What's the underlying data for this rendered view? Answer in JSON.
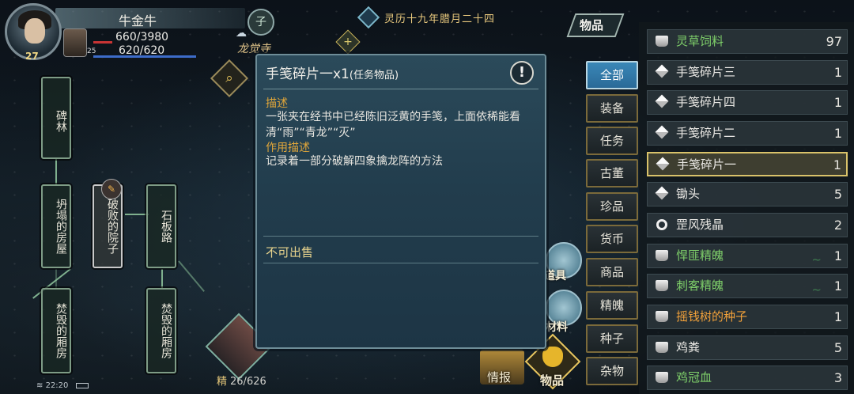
{
  "player": {
    "name": "牛金牛",
    "level": "27",
    "hp": "660/3980",
    "mp": "620/620",
    "pet_level": "25"
  },
  "top": {
    "zi_label": "子",
    "location": "龙觉寺",
    "date": "灵历十九年腊月二十四",
    "search_icon": "magnifier-icon",
    "plus_label": "+"
  },
  "map": {
    "nodes": [
      {
        "label": "碑林"
      },
      {
        "label": "坍塌的房屋"
      },
      {
        "label": "破败的院子"
      },
      {
        "label": "石板路"
      },
      {
        "label": "焚毁的厢房"
      },
      {
        "label": "焚毁的厢房"
      }
    ]
  },
  "energy": {
    "label": "精",
    "value": "26/626"
  },
  "status": {
    "time": "22:20"
  },
  "popup": {
    "title": "手笺碎片一x1",
    "type": "(任务物品)",
    "info_label": "!",
    "desc_heading": "描述",
    "desc_text": "一张夹在经书中已经陈旧泛黄的手笺，上面依稀能看清“雨”“青龙”“灭”",
    "effect_heading": "作用描述",
    "effect_text": "记录着一部分破解四象擒龙阵的方法",
    "sell_note": "不可出售"
  },
  "inventory": {
    "title": "物品",
    "categories": [
      "全部",
      "装备",
      "任务",
      "古董",
      "珍品",
      "货币",
      "商品",
      "精魄",
      "种子",
      "杂物"
    ],
    "selected_category": "全部",
    "items": [
      {
        "name": "灵草饲料",
        "count": "97",
        "icon": "ingot-icon",
        "color": "green"
      },
      {
        "name": "手笺碎片三",
        "count": "1",
        "icon": "paper-icon",
        "color": "white"
      },
      {
        "name": "手笺碎片四",
        "count": "1",
        "icon": "paper-icon",
        "color": "white"
      },
      {
        "name": "手笺碎片二",
        "count": "1",
        "icon": "paper-icon",
        "color": "white"
      },
      {
        "name": "手笺碎片一",
        "count": "1",
        "icon": "paper-icon",
        "color": "white",
        "selected": true
      },
      {
        "name": "锄头",
        "count": "5",
        "icon": "paper-icon",
        "color": "white"
      },
      {
        "name": "罡风残晶",
        "count": "2",
        "icon": "ring-icon",
        "color": "white"
      },
      {
        "name": "悍匪精魄",
        "count": "1",
        "icon": "ingot-icon",
        "color": "green"
      },
      {
        "name": "刺客精魄",
        "count": "1",
        "icon": "ingot-icon",
        "color": "green"
      },
      {
        "name": "摇钱树的种子",
        "count": "1",
        "icon": "ingot-icon",
        "color": "orange"
      },
      {
        "name": "鸡粪",
        "count": "5",
        "icon": "ingot-icon",
        "color": "white"
      },
      {
        "name": "鸡冠血",
        "count": "3",
        "icon": "ingot-icon",
        "color": "green"
      }
    ]
  },
  "bottom_menu": {
    "daoju": "道具",
    "cailiao": "材料",
    "qingbao": "情报",
    "wupin": "物品"
  },
  "colors": {
    "accent_gold": "#d9c26a",
    "selected_tab": "#2a6a98",
    "rare_green": "#7fd06a",
    "rare_orange": "#f2a13a"
  }
}
